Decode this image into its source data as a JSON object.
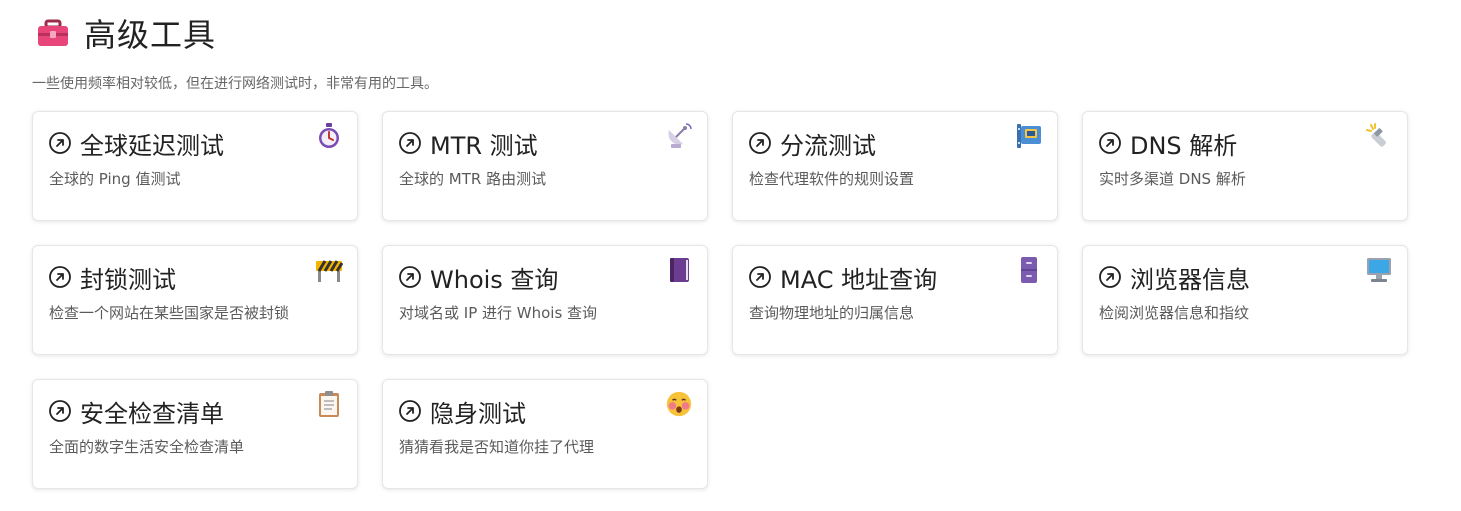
{
  "header": {
    "icon": "toolbox-icon",
    "title": "高级工具",
    "subtitle": "一些使用频率相对较低，但在进行网络测试时，非常有用的工具。"
  },
  "cards": [
    {
      "title": "全球延迟测试",
      "desc": "全球的 Ping 值测试",
      "icon": "stopwatch-icon"
    },
    {
      "title": "MTR 测试",
      "desc": "全球的 MTR 路由测试",
      "icon": "satellite-dish-icon"
    },
    {
      "title": "分流测试",
      "desc": "检查代理软件的规则设置",
      "icon": "control-panel-icon"
    },
    {
      "title": "DNS 解析",
      "desc": "实时多渠道 DNS 解析",
      "icon": "flashlight-icon"
    },
    {
      "title": "封锁测试",
      "desc": "检查一个网站在某些国家是否被封锁",
      "icon": "construction-barrier-icon"
    },
    {
      "title": "Whois 查询",
      "desc": "对域名或 IP 进行 Whois 查询",
      "icon": "book-icon"
    },
    {
      "title": "MAC 地址查询",
      "desc": "查询物理地址的归属信息",
      "icon": "file-cabinet-icon"
    },
    {
      "title": "浏览器信息",
      "desc": "检阅浏览器信息和指纹",
      "icon": "desktop-computer-icon"
    },
    {
      "title": "安全检查清单",
      "desc": "全面的数字生活安全检查清单",
      "icon": "clipboard-icon"
    },
    {
      "title": "隐身测试",
      "desc": "猜猜看我是否知道你挂了代理",
      "icon": "face-emoji-icon"
    }
  ]
}
